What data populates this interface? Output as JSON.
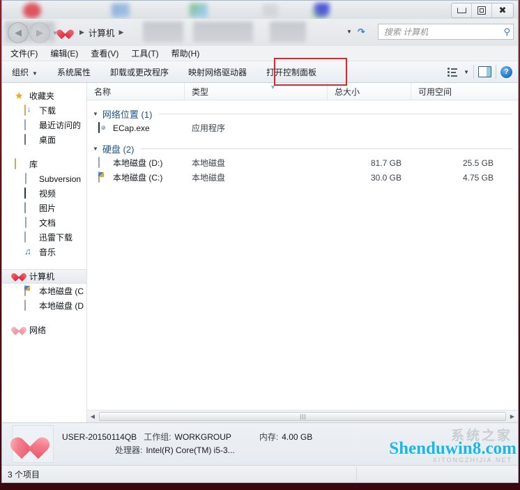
{
  "window": {
    "minimize_label": "—",
    "maximize_label": "□",
    "close_label": "✕"
  },
  "address": {
    "back_label": "◀",
    "forward_label": "▶",
    "history_caret": "▾",
    "crumb_computer": "计算机",
    "separator": "▶"
  },
  "search": {
    "placeholder": "搜索 计算机",
    "caret": "▾",
    "refresh": "↻",
    "magnifier": "⚲"
  },
  "menu": {
    "items": [
      {
        "label": "文件(F)"
      },
      {
        "label": "编辑(E)"
      },
      {
        "label": "查看(V)"
      },
      {
        "label": "工具(T)"
      },
      {
        "label": "帮助(H)"
      }
    ]
  },
  "toolbar": {
    "organize": "组织",
    "organize_caret": "▾",
    "system_properties": "系统属性",
    "uninstall_change": "卸载或更改程序",
    "map_network_drive": "映射网络驱动器",
    "open_control_panel": "打开控制面板",
    "views_caret": "▾",
    "help_label": "?",
    "highlight_color": "#e8242b"
  },
  "sidebar": {
    "favorites": {
      "label": "收藏夹"
    },
    "favorites_items": [
      {
        "label": "下载"
      },
      {
        "label": "最近访问的"
      },
      {
        "label": "桌面"
      }
    ],
    "libraries": {
      "label": "库"
    },
    "library_items": [
      {
        "label": "Subversion"
      },
      {
        "label": "视频"
      },
      {
        "label": "图片"
      },
      {
        "label": "文档"
      },
      {
        "label": "迅雷下载"
      },
      {
        "label": "音乐"
      }
    ],
    "computer": {
      "label": "计算机"
    },
    "computer_items": [
      {
        "label": "本地磁盘 (C"
      },
      {
        "label": "本地磁盘 (D"
      }
    ],
    "network": {
      "label": "网络"
    }
  },
  "columns": {
    "name": "名称",
    "type": "类型",
    "total_size": "总大小",
    "free_space": "可用空间"
  },
  "groups": [
    {
      "title": "网络位置 (1)",
      "triangle": "◢",
      "rows": [
        {
          "name": "ECap.exe",
          "type": "应用程序",
          "size": "",
          "free": ""
        }
      ]
    },
    {
      "title": "硬盘 (2)",
      "triangle": "◢",
      "rows": [
        {
          "name": "本地磁盘 (D:)",
          "type": "本地磁盘",
          "size": "81.7 GB",
          "free": "25.5 GB"
        },
        {
          "name": "本地磁盘 (C:)",
          "type": "本地磁盘",
          "size": "30.0 GB",
          "free": "4.75 GB"
        }
      ]
    }
  ],
  "scrollbar": {
    "left_arrow": "◀",
    "right_arrow": "▶"
  },
  "details": {
    "computer_name": "USER-20150114QB",
    "workgroup_key": "工作组:",
    "workgroup_value": "WORKGROUP",
    "memory_key": "内存:",
    "memory_value": "4.00 GB",
    "processor_key": "处理器:",
    "processor_value": "Intel(R) Core(TM) i5-3..."
  },
  "status": {
    "item_count": "3 个项目"
  },
  "watermark": {
    "main": "Shenduwin8.com",
    "ghost": "系统之家",
    "sub": "XITONGZHIJIA.NET",
    "color": "#18b6ea"
  }
}
